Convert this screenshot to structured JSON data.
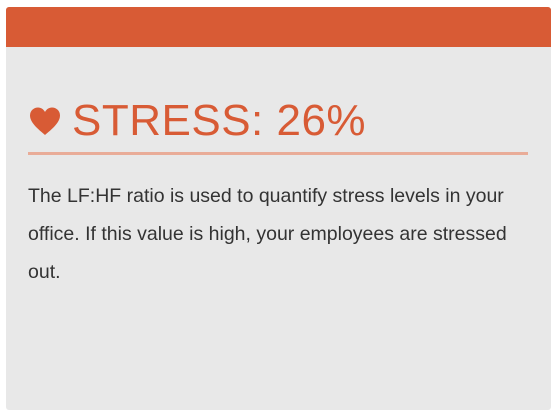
{
  "card": {
    "title": "STRESS: 26%",
    "icon": "heart-icon",
    "description": "The LF:HF ratio is used to quantify stress levels in your office. If this value is high, your employees are stressed out."
  },
  "colors": {
    "accent": "#d85b35",
    "divider": "#e9ac98",
    "card_background": "#e8e8e8",
    "text": "#333333"
  }
}
